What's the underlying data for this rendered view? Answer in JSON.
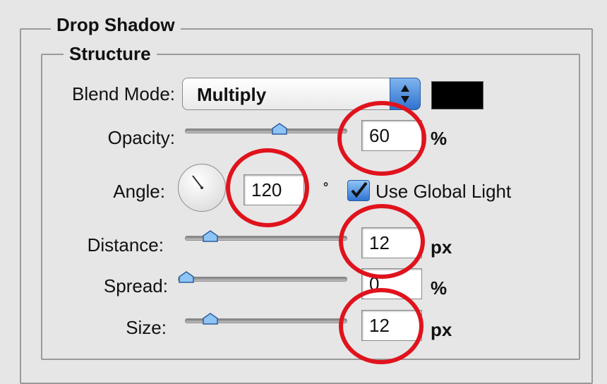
{
  "panel": {
    "title": "Drop Shadow",
    "section": "Structure"
  },
  "blend_mode": {
    "label": "Blend Mode:",
    "value": "Multiply",
    "color": "#000000"
  },
  "opacity": {
    "label": "Opacity:",
    "value": "60",
    "unit": "%",
    "slider_level": 0.6
  },
  "angle": {
    "label": "Angle:",
    "value": "120",
    "unit": "°",
    "use_global_light_label": "Use Global Light",
    "use_global_light_checked": true
  },
  "distance": {
    "label": "Distance:",
    "value": "12",
    "unit": "px",
    "slider_level": 0.12
  },
  "spread": {
    "label": "Spread:",
    "value": "0",
    "unit": "%",
    "slider_level": 0.0
  },
  "size": {
    "label": "Size:",
    "value": "12",
    "unit": "px",
    "slider_level": 0.12
  },
  "colors": {
    "annotation_ring": "#e0131d",
    "accent": "#2f73cf"
  },
  "icons": {
    "select_arrows": "up-down-arrows-icon",
    "checkmark": "checkmark-icon",
    "slider_thumb": "slider-thumb-icon"
  }
}
